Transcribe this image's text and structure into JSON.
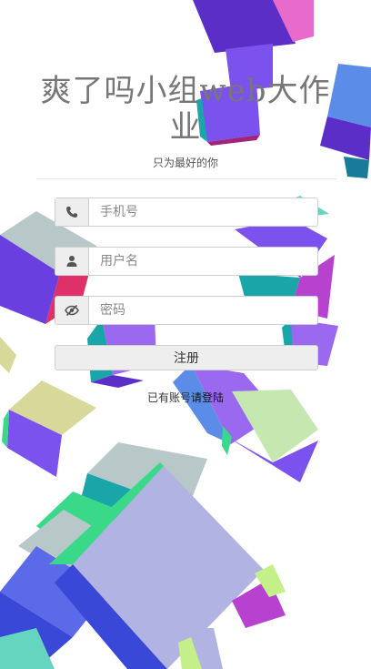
{
  "header": {
    "title": "爽了吗小组web大作业",
    "subtitle": "只为最好的你"
  },
  "form": {
    "phone": {
      "placeholder": "手机号",
      "icon": "phone-icon"
    },
    "username": {
      "placeholder": "用户名",
      "icon": "user-icon"
    },
    "password": {
      "placeholder": "密码",
      "icon": "eye-slash-icon"
    },
    "submit_label": "注册"
  },
  "footer": {
    "prompt": "已有账号",
    "login_link": "请登陆"
  },
  "colors": {
    "cube_purple": "#7b52ee",
    "cube_blue": "#5b8de8",
    "cube_teal": "#1aa5a8",
    "cube_green": "#3ad98a",
    "cube_lavender": "#b1b3e2",
    "cube_pink": "#e86bcc"
  }
}
